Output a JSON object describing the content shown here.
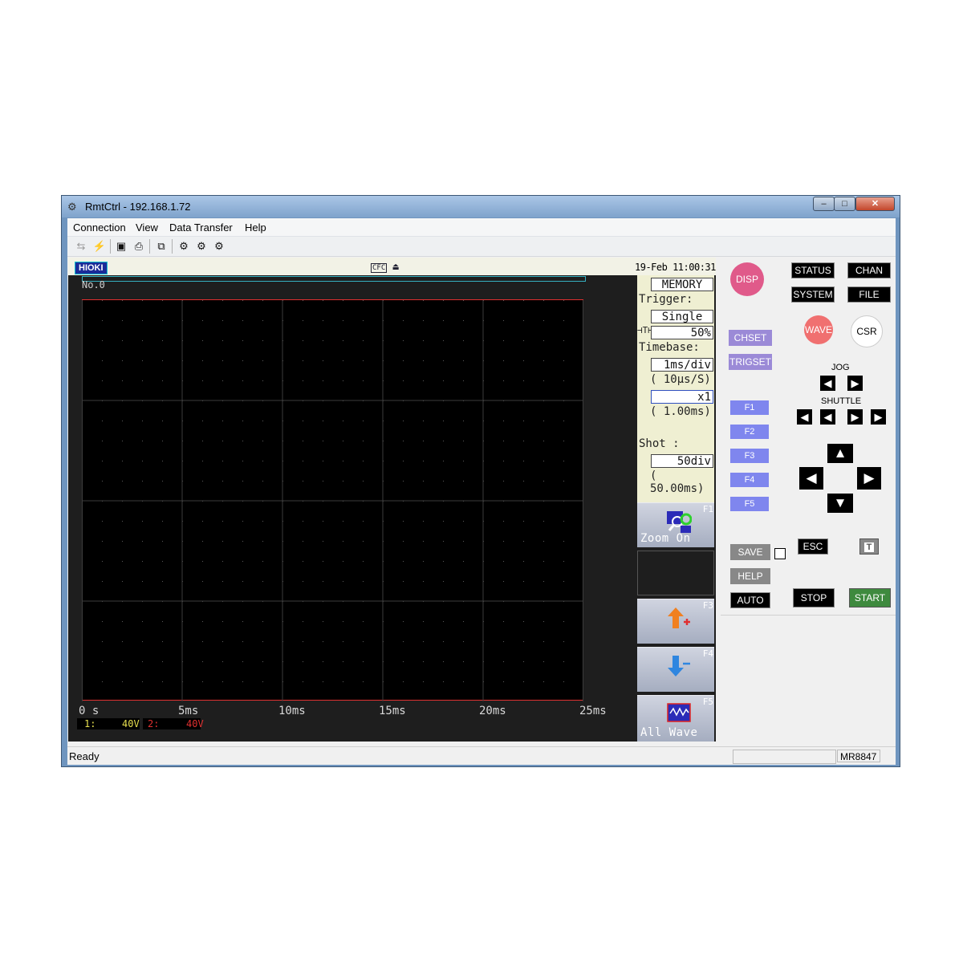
{
  "window": {
    "title": "RmtCtrl - 192.168.1.72",
    "buttons": {
      "minimize": "–",
      "maximize": "□",
      "close": "✕"
    }
  },
  "menu": [
    "Connection",
    "View",
    "Data Transfer",
    "Help"
  ],
  "toolbar": {
    "icons": [
      "connect-icon",
      "disconnect-icon",
      "save-icon",
      "print-icon",
      "copy-screen-icon",
      "settings-icon",
      "download-icon",
      "transfer-icon"
    ]
  },
  "instrument": {
    "brand": "HIOKI",
    "media": "CFC",
    "clock": "19-Feb 11:00:31",
    "record_no": "No.0",
    "x_ticks": [
      "0 s",
      "5ms",
      "10ms",
      "15ms",
      "20ms",
      "25ms"
    ],
    "channels": [
      {
        "label": "1:",
        "range": "40V",
        "color": "#e8e050"
      },
      {
        "label": "2:",
        "range": "40V",
        "color": "#e03030"
      }
    ],
    "settings": {
      "mode": "MEMORY",
      "trigger_label": "Trigger:",
      "trigger_mode": "Single",
      "pretrigger": "50%",
      "timebase_label": "Timebase:",
      "timebase": "1ms/div",
      "sample_rate": "(  10µs/S)",
      "zoom": "x1",
      "zoom_time": "(  1.00ms)",
      "shot_label": "Shot    :",
      "shot": "50div",
      "shot_time": "( 50.00ms)"
    },
    "fkeys": [
      {
        "num": "F1",
        "label": "Zoom On"
      },
      {
        "num": "F3",
        "label": ""
      },
      {
        "num": "F4",
        "label": ""
      },
      {
        "num": "F5",
        "label": "All Wave"
      }
    ]
  },
  "panel": {
    "disp": "DISP",
    "status": "STATUS",
    "chan": "CHAN",
    "system": "SYSTEM",
    "file": "FILE",
    "chset": "CHSET",
    "trigset": "TRIGSET",
    "wave": "WAVE",
    "csr": "CSR",
    "jog": "JOG",
    "shuttle": "SHUTTLE",
    "f_buttons": [
      "F1",
      "F2",
      "F3",
      "F4",
      "F5"
    ],
    "save": "SAVE",
    "esc": "ESC",
    "help": "HELP",
    "auto": "AUTO",
    "stop": "STOP",
    "start": "START",
    "colors": {
      "disp": "#e05a8a",
      "wave": "#f07070",
      "start": "#3e8a3e"
    }
  },
  "statusbar": {
    "text": "Ready",
    "model": "MR8847"
  }
}
